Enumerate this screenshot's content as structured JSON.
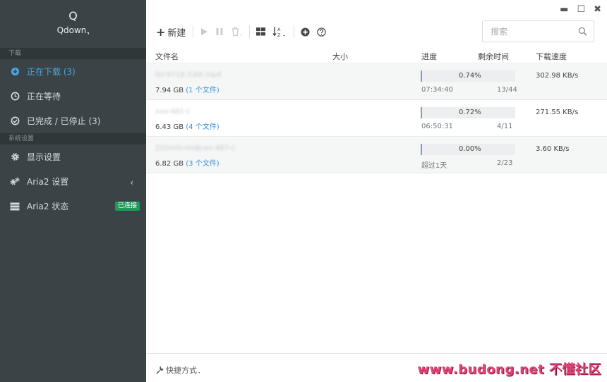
{
  "brand": {
    "logo": "Q",
    "name": "Qdown"
  },
  "sidebar": {
    "section_download": "下载",
    "items": [
      {
        "label": "正在下载 (3)",
        "icon": "download-circle-icon",
        "active": true
      },
      {
        "label": "正在等待",
        "icon": "clock-icon"
      },
      {
        "label": "已完成 / 已停止 (3)",
        "icon": "check-circle-icon"
      }
    ],
    "section_settings": "系统设置",
    "settings": [
      {
        "label": "显示设置",
        "icon": "gear-icon"
      },
      {
        "label": "Aria2 设置",
        "icon": "gears-icon",
        "chevron": "‹"
      },
      {
        "label": "Aria2 状态",
        "icon": "server-icon",
        "badge": "已连接"
      }
    ]
  },
  "window": {
    "minimize": "▬",
    "maximize": "☐",
    "close": "✖"
  },
  "toolbar": {
    "new_label": "新建"
  },
  "search": {
    "placeholder": "搜索"
  },
  "table": {
    "headers": {
      "name": "文件名",
      "size": "大小",
      "progress": "进度",
      "remaining": "剩余时间",
      "speed": "下载速度"
    },
    "rows": [
      {
        "name": "fel-9718-330t.mp4",
        "size": "7.94 GB",
        "count": "(1 个文件)",
        "percent": "0.74%",
        "progress": 0.0074,
        "remaining": "07:34:40",
        "pieces": "13/44",
        "speed": "302.98 KB/s"
      },
      {
        "name": "xxx-481-c",
        "size": "6.43 GB",
        "count": "(4 个文件)",
        "percent": "0.72%",
        "progress": 0.0072,
        "remaining": "06:50:31",
        "pieces": "4/11",
        "speed": "271.55 KB/s"
      },
      {
        "name": "222mhi-midjcen-487-c",
        "size": "6.82 GB",
        "count": "(3 个文件)",
        "percent": "0.00%",
        "progress": 0.0,
        "remaining": "超过1天",
        "pieces": "2/23",
        "speed": "3.60 KB/s"
      }
    ]
  },
  "footer": {
    "shortcut_label": "快捷方式"
  },
  "watermark": "www.budong.net 不懂社区",
  "colors": {
    "sidebar_bg": "#3a4447",
    "accent": "#4aa3df",
    "badge_green": "#1e9a5a",
    "progress_fill": "#61a9d8"
  }
}
